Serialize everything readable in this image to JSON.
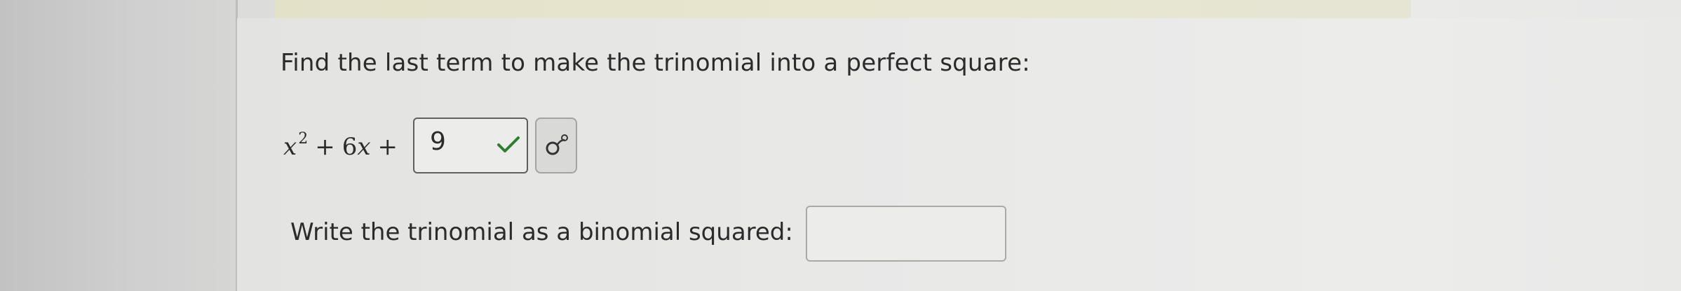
{
  "question": {
    "prompt": "Find the last term to make the trinomial into a perfect square:"
  },
  "expression": {
    "variable": "x",
    "exponent": "2",
    "plus1": "+",
    "coefficient": "6",
    "variable2": "x",
    "plus2": "+"
  },
  "answer_box": {
    "value": "9",
    "status_icon": "check-icon",
    "status_color": "#2e7d32"
  },
  "symbol_button": {
    "icon": "superscript-icon"
  },
  "binomial": {
    "label": "Write the trinomial as a binomial squared:",
    "value": ""
  },
  "colors": {
    "text": "#2b2b2b",
    "banner": "#e6e4cd",
    "gutter": "#c9c9c9"
  }
}
